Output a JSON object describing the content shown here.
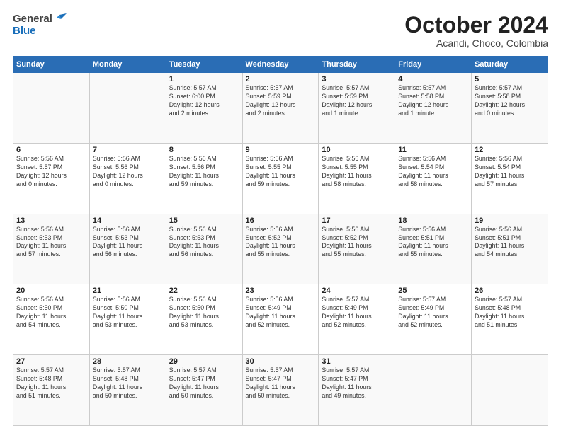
{
  "header": {
    "logo_general": "General",
    "logo_blue": "Blue",
    "month_title": "October 2024",
    "location": "Acandi, Choco, Colombia"
  },
  "days_of_week": [
    "Sunday",
    "Monday",
    "Tuesday",
    "Wednesday",
    "Thursday",
    "Friday",
    "Saturday"
  ],
  "weeks": [
    [
      {
        "day": "",
        "info": ""
      },
      {
        "day": "",
        "info": ""
      },
      {
        "day": "1",
        "info": "Sunrise: 5:57 AM\nSunset: 6:00 PM\nDaylight: 12 hours\nand 2 minutes."
      },
      {
        "day": "2",
        "info": "Sunrise: 5:57 AM\nSunset: 5:59 PM\nDaylight: 12 hours\nand 2 minutes."
      },
      {
        "day": "3",
        "info": "Sunrise: 5:57 AM\nSunset: 5:59 PM\nDaylight: 12 hours\nand 1 minute."
      },
      {
        "day": "4",
        "info": "Sunrise: 5:57 AM\nSunset: 5:58 PM\nDaylight: 12 hours\nand 1 minute."
      },
      {
        "day": "5",
        "info": "Sunrise: 5:57 AM\nSunset: 5:58 PM\nDaylight: 12 hours\nand 0 minutes."
      }
    ],
    [
      {
        "day": "6",
        "info": "Sunrise: 5:56 AM\nSunset: 5:57 PM\nDaylight: 12 hours\nand 0 minutes."
      },
      {
        "day": "7",
        "info": "Sunrise: 5:56 AM\nSunset: 5:56 PM\nDaylight: 12 hours\nand 0 minutes."
      },
      {
        "day": "8",
        "info": "Sunrise: 5:56 AM\nSunset: 5:56 PM\nDaylight: 11 hours\nand 59 minutes."
      },
      {
        "day": "9",
        "info": "Sunrise: 5:56 AM\nSunset: 5:55 PM\nDaylight: 11 hours\nand 59 minutes."
      },
      {
        "day": "10",
        "info": "Sunrise: 5:56 AM\nSunset: 5:55 PM\nDaylight: 11 hours\nand 58 minutes."
      },
      {
        "day": "11",
        "info": "Sunrise: 5:56 AM\nSunset: 5:54 PM\nDaylight: 11 hours\nand 58 minutes."
      },
      {
        "day": "12",
        "info": "Sunrise: 5:56 AM\nSunset: 5:54 PM\nDaylight: 11 hours\nand 57 minutes."
      }
    ],
    [
      {
        "day": "13",
        "info": "Sunrise: 5:56 AM\nSunset: 5:53 PM\nDaylight: 11 hours\nand 57 minutes."
      },
      {
        "day": "14",
        "info": "Sunrise: 5:56 AM\nSunset: 5:53 PM\nDaylight: 11 hours\nand 56 minutes."
      },
      {
        "day": "15",
        "info": "Sunrise: 5:56 AM\nSunset: 5:53 PM\nDaylight: 11 hours\nand 56 minutes."
      },
      {
        "day": "16",
        "info": "Sunrise: 5:56 AM\nSunset: 5:52 PM\nDaylight: 11 hours\nand 55 minutes."
      },
      {
        "day": "17",
        "info": "Sunrise: 5:56 AM\nSunset: 5:52 PM\nDaylight: 11 hours\nand 55 minutes."
      },
      {
        "day": "18",
        "info": "Sunrise: 5:56 AM\nSunset: 5:51 PM\nDaylight: 11 hours\nand 55 minutes."
      },
      {
        "day": "19",
        "info": "Sunrise: 5:56 AM\nSunset: 5:51 PM\nDaylight: 11 hours\nand 54 minutes."
      }
    ],
    [
      {
        "day": "20",
        "info": "Sunrise: 5:56 AM\nSunset: 5:50 PM\nDaylight: 11 hours\nand 54 minutes."
      },
      {
        "day": "21",
        "info": "Sunrise: 5:56 AM\nSunset: 5:50 PM\nDaylight: 11 hours\nand 53 minutes."
      },
      {
        "day": "22",
        "info": "Sunrise: 5:56 AM\nSunset: 5:50 PM\nDaylight: 11 hours\nand 53 minutes."
      },
      {
        "day": "23",
        "info": "Sunrise: 5:56 AM\nSunset: 5:49 PM\nDaylight: 11 hours\nand 52 minutes."
      },
      {
        "day": "24",
        "info": "Sunrise: 5:57 AM\nSunset: 5:49 PM\nDaylight: 11 hours\nand 52 minutes."
      },
      {
        "day": "25",
        "info": "Sunrise: 5:57 AM\nSunset: 5:49 PM\nDaylight: 11 hours\nand 52 minutes."
      },
      {
        "day": "26",
        "info": "Sunrise: 5:57 AM\nSunset: 5:48 PM\nDaylight: 11 hours\nand 51 minutes."
      }
    ],
    [
      {
        "day": "27",
        "info": "Sunrise: 5:57 AM\nSunset: 5:48 PM\nDaylight: 11 hours\nand 51 minutes."
      },
      {
        "day": "28",
        "info": "Sunrise: 5:57 AM\nSunset: 5:48 PM\nDaylight: 11 hours\nand 50 minutes."
      },
      {
        "day": "29",
        "info": "Sunrise: 5:57 AM\nSunset: 5:47 PM\nDaylight: 11 hours\nand 50 minutes."
      },
      {
        "day": "30",
        "info": "Sunrise: 5:57 AM\nSunset: 5:47 PM\nDaylight: 11 hours\nand 50 minutes."
      },
      {
        "day": "31",
        "info": "Sunrise: 5:57 AM\nSunset: 5:47 PM\nDaylight: 11 hours\nand 49 minutes."
      },
      {
        "day": "",
        "info": ""
      },
      {
        "day": "",
        "info": ""
      }
    ]
  ]
}
